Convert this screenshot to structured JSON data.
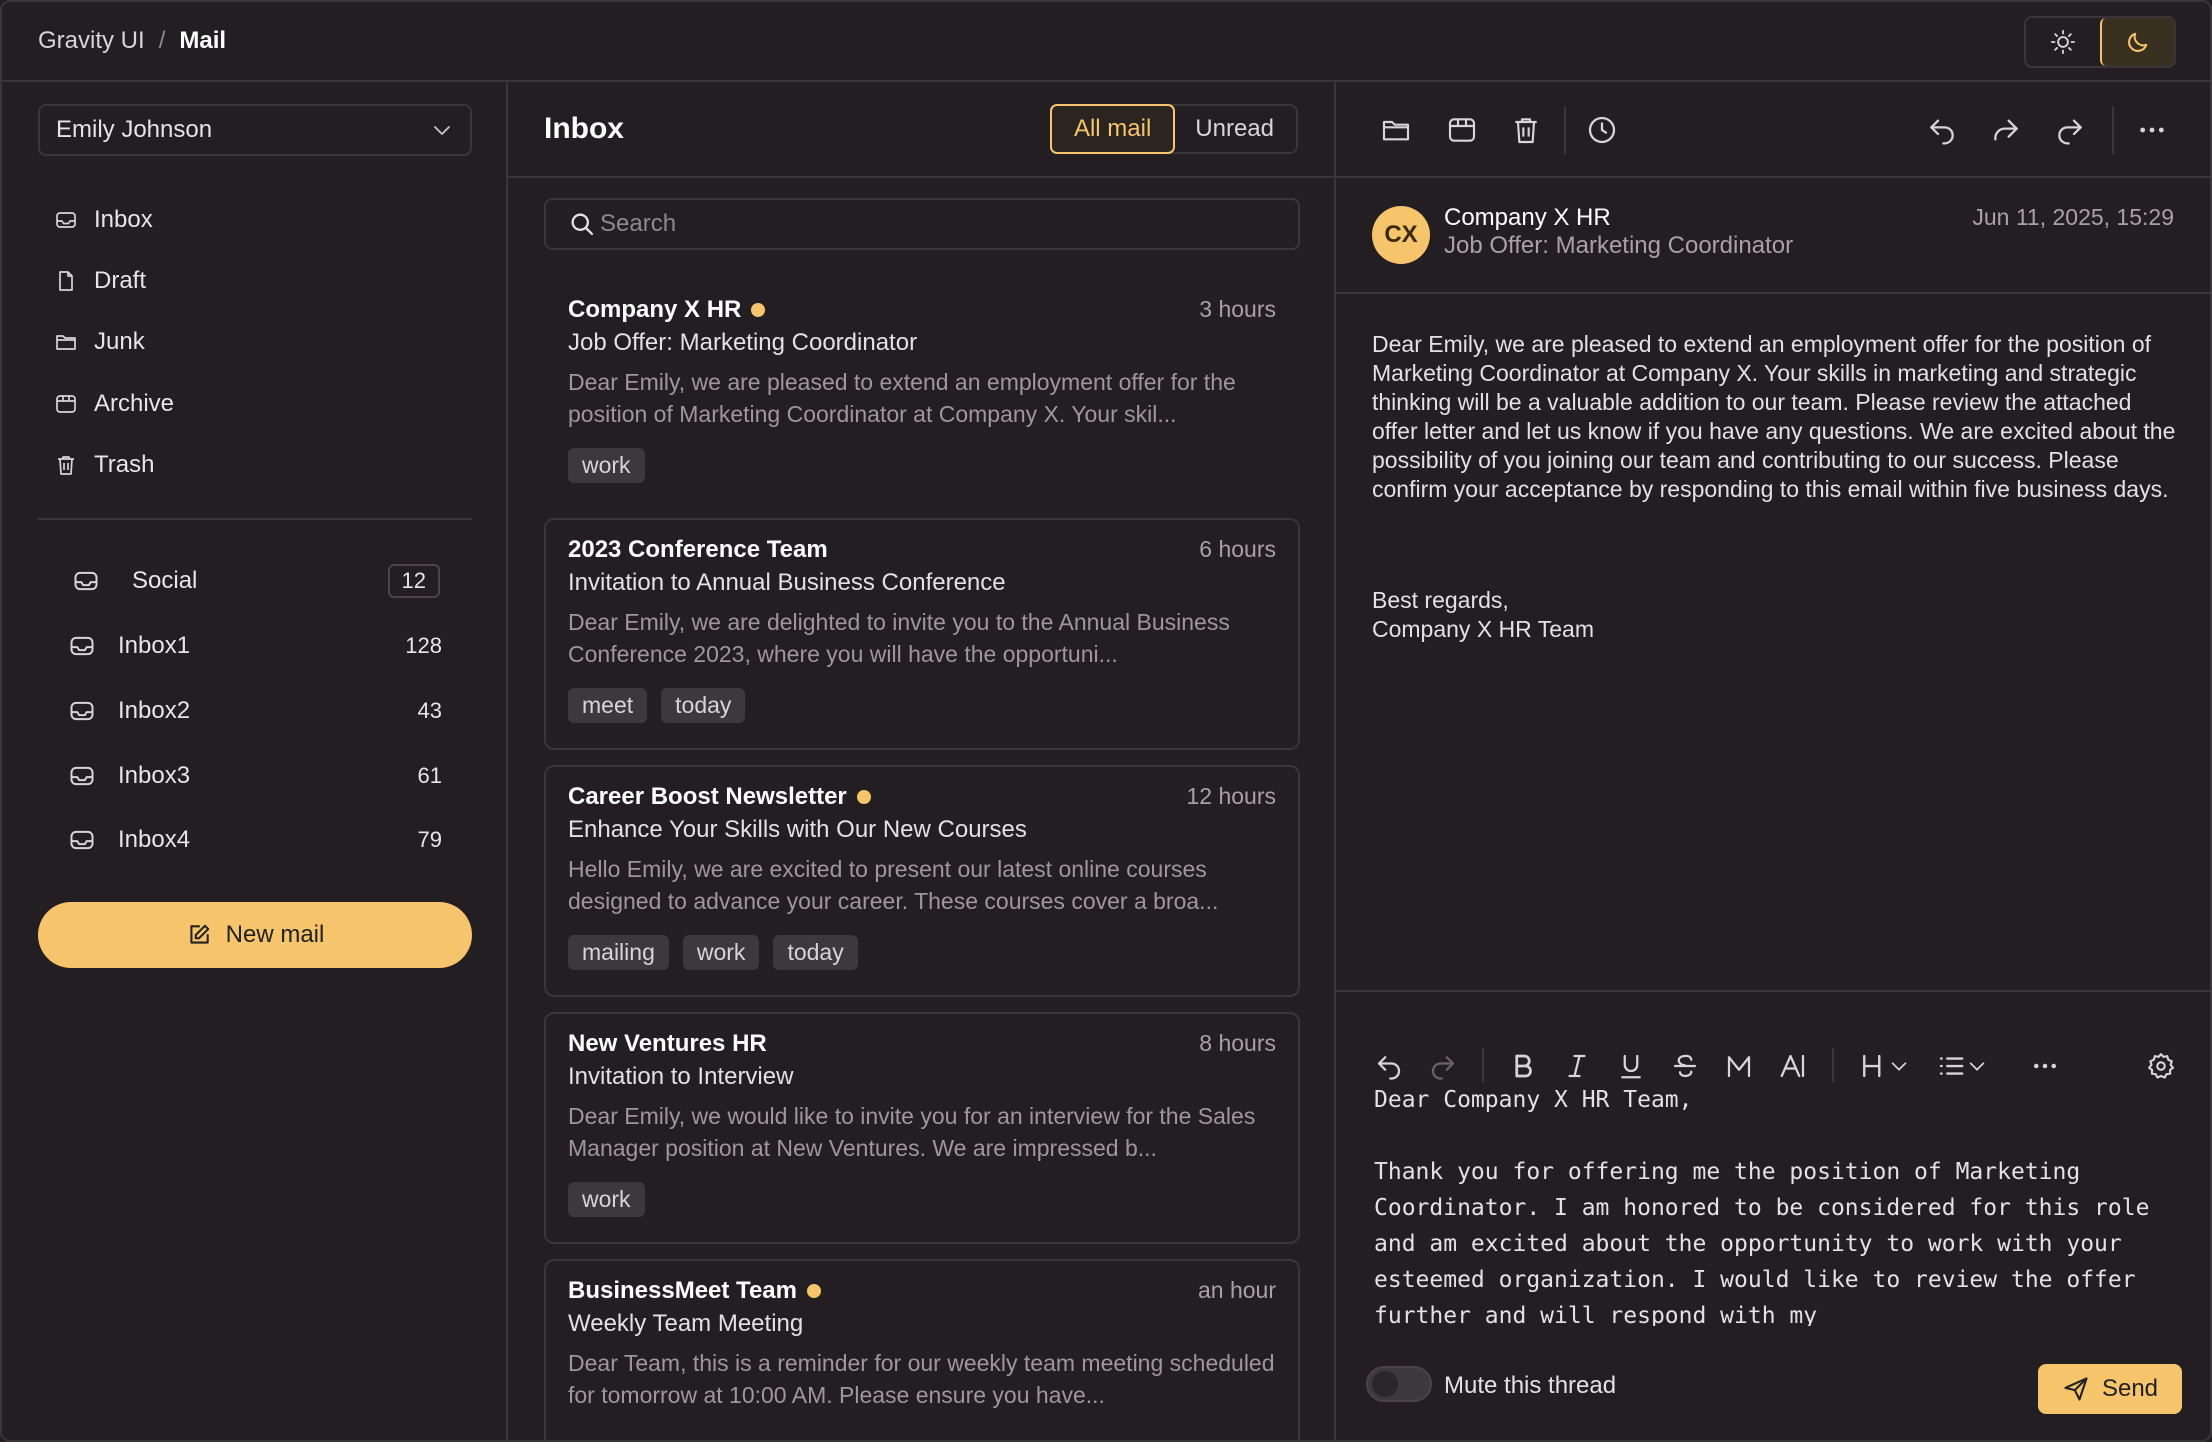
{
  "breadcrumb": {
    "root": "Gravity UI",
    "separator": "/",
    "current": "Mail"
  },
  "theme": {
    "light_icon": "sun-icon",
    "dark_icon": "moon-icon",
    "active": "dark"
  },
  "sidebar": {
    "account": "Emily Johnson",
    "nav": [
      {
        "label": "Inbox",
        "icon": "inbox-icon"
      },
      {
        "label": "Draft",
        "icon": "file-icon"
      },
      {
        "label": "Junk",
        "icon": "folder-icon"
      },
      {
        "label": "Archive",
        "icon": "archive-icon"
      },
      {
        "label": "Trash",
        "icon": "trash-icon"
      }
    ],
    "folders": [
      {
        "label": "Social",
        "count": "12"
      },
      {
        "label": "Inbox1",
        "count": "128"
      },
      {
        "label": "Inbox2",
        "count": "43"
      },
      {
        "label": "Inbox3",
        "count": "61"
      },
      {
        "label": "Inbox4",
        "count": "79"
      }
    ],
    "new_mail": "New mail"
  },
  "list": {
    "title": "Inbox",
    "filters": [
      "All mail",
      "Unread"
    ],
    "active_filter": "All mail",
    "search_placeholder": "Search",
    "emails": [
      {
        "from": "Company X HR",
        "unread": true,
        "time": "3 hours",
        "subject": "Job Offer: Marketing Coordinator",
        "preview": "Dear Emily, we are pleased to extend an employment offer for the position of Marketing Coordinator at Company X. Your skil...",
        "tags": [
          "work"
        ]
      },
      {
        "from": "2023 Conference Team",
        "unread": false,
        "time": "6 hours",
        "subject": "Invitation to Annual Business Conference",
        "preview": "Dear Emily, we are delighted to invite you to the Annual Business Conference 2023, where you will have the opportuni...",
        "tags": [
          "meet",
          "today"
        ]
      },
      {
        "from": "Career Boost Newsletter",
        "unread": true,
        "time": "12 hours",
        "subject": "Enhance Your Skills with Our New Courses",
        "preview": "Hello Emily, we are excited to present our latest online courses designed to advance your career. These courses cover a broa...",
        "tags": [
          "mailing",
          "work",
          "today"
        ]
      },
      {
        "from": "New Ventures HR",
        "unread": false,
        "time": "8 hours",
        "subject": "Invitation to Interview",
        "preview": "Dear Emily, we would like to invite you for an interview for the Sales Manager position at New Ventures. We are impressed b...",
        "tags": [
          "work"
        ]
      },
      {
        "from": "BusinessMeet Team",
        "unread": true,
        "time": "an hour",
        "subject": "Weekly Team Meeting",
        "preview": "Dear Team, this is a reminder for our weekly team meeting scheduled for tomorrow at 10:00 AM. Please ensure you have...",
        "tags": []
      }
    ]
  },
  "message": {
    "avatar": "CX",
    "from": "Company X HR",
    "subject": "Job Offer: Marketing Coordinator",
    "date": "Jun 11, 2025, 15:29",
    "body": "Dear Emily, we are pleased to extend an employment offer for the position of Marketing Coordinator at Company X. Your skills in marketing and strategic thinking will be a valuable addition to our team. Please review the attached offer letter and let us know if you have any questions. We are excited about the possibility of you joining our team and contributing to our success. Please confirm your acceptance by responding to this email within five business days.",
    "sign_1": "Best regards,",
    "sign_2": "Company X HR Team"
  },
  "compose": {
    "text": "Dear Company X HR Team,\n\nThank you for offering me the position of Marketing Coordinator. I am honored to be considered for this role and am excited about the opportunity to work with your esteemed organization. I would like to review the offer further and will respond with my",
    "mute_label": "Mute this thread",
    "mute_on": false,
    "send": "Send"
  },
  "colors": {
    "accent": "#f6c46a",
    "background": "#221e22",
    "border": "#3a353a"
  }
}
